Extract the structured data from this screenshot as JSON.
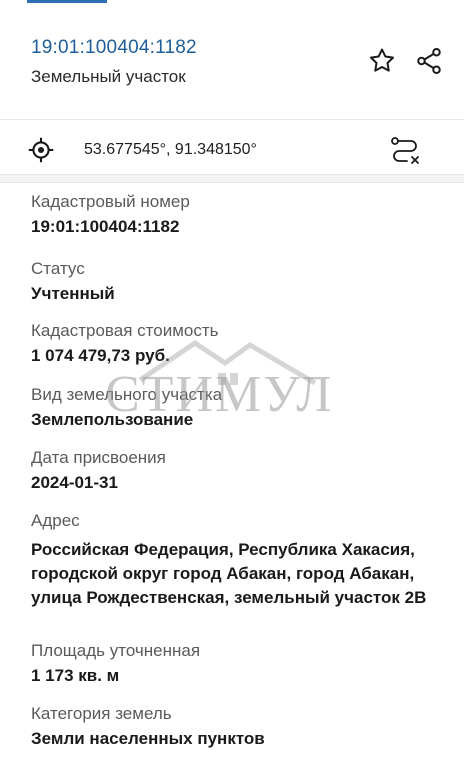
{
  "header": {
    "cadastral_number": "19:01:100404:1182",
    "object_type": "Земельный участок"
  },
  "coordinates": {
    "text": "53.677545°, 91.348150°"
  },
  "fields": {
    "cad_number_label": "Кадастровый номер",
    "cad_number_value": "19:01:100404:1182",
    "status_label": "Статус",
    "status_value": "Учтенный",
    "cost_label": "Кадастровая стоимость",
    "cost_value": "1 074 479,73 руб.",
    "usage_label": "Вид земельного участка",
    "usage_value": "Землепользование",
    "date_label": "Дата присвоения",
    "date_value": "2024-01-31",
    "address_label": "Адрес",
    "address_value": "Российская Федерация, Республика Хакасия, городской округ город Абакан, город Абакан, улица Рождественская, земельный участок 2В",
    "area_label": "Площадь уточненная",
    "area_value": "1 173 кв. м",
    "category_label": "Категория земель",
    "category_value": "Земли населенных пунктов"
  },
  "watermark": {
    "text": "СТИМУЛ"
  },
  "icons": {
    "star": "star-outline-icon",
    "share": "share-icon",
    "location": "crosshair-location-icon",
    "route": "route-cancel-icon"
  }
}
